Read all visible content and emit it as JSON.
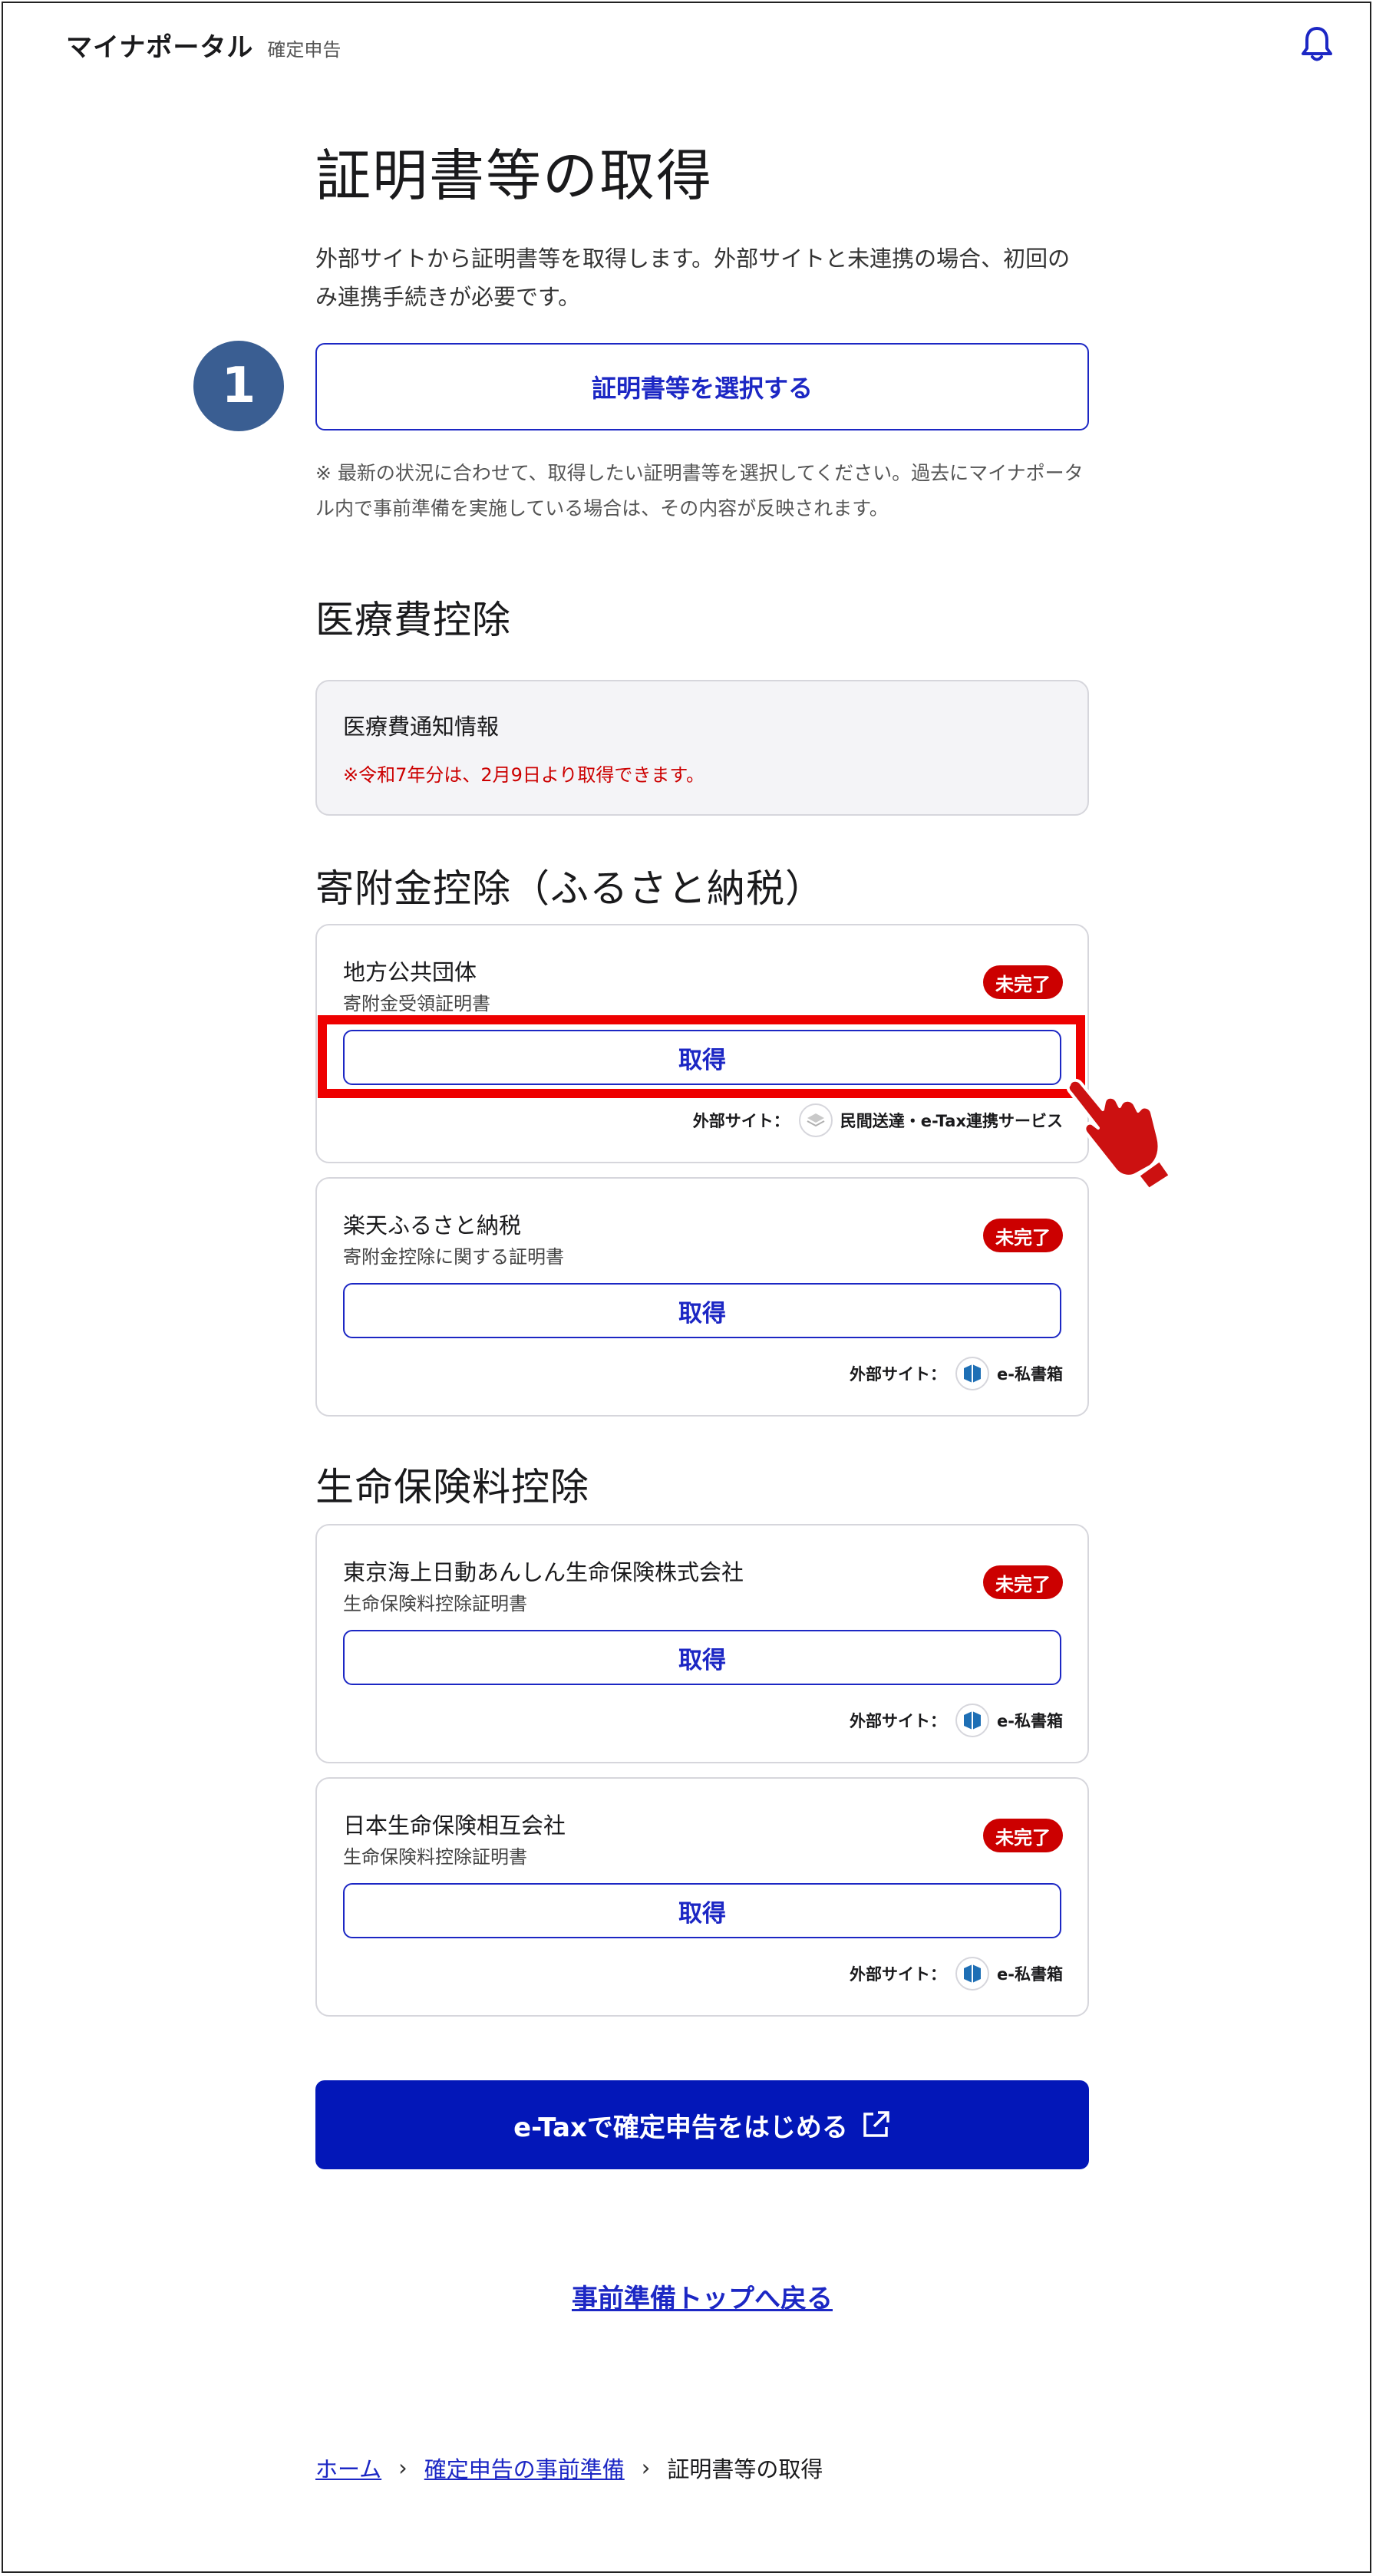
{
  "header": {
    "brand": "マイナポータル",
    "sub": "確定申告"
  },
  "page_title": "証明書等の取得",
  "lead": "外部サイトから証明書等を取得します。外部サイトと未連携の場合、初回のみ連携手続きが必要です。",
  "step_number": "1",
  "select_button": "証明書等を選択する",
  "note": "※ 最新の状況に合わせて、取得したい証明書等を選択してください。過去にマイナポータル内で事前準備を実施している場合は、その内容が反映されます。",
  "sections": {
    "medical": {
      "heading": "医療費控除",
      "card_title": "医療費通知情報",
      "card_warning": "※令和7年分は、2月9日より取得できます。"
    },
    "donation": {
      "heading": "寄附金控除（ふるさと納税）",
      "cards": [
        {
          "title": "地方公共団体",
          "subtitle": "寄附金受領証明書",
          "status": "未完了",
          "button": "取得",
          "ext_label": "外部サイト：",
          "ext_name": "民間送達・e-Tax連携サービス"
        },
        {
          "title": "楽天ふるさと納税",
          "subtitle": "寄附金控除に関する証明書",
          "status": "未完了",
          "button": "取得",
          "ext_label": "外部サイト：",
          "ext_name": "e-私書箱"
        }
      ]
    },
    "life": {
      "heading": "生命保険料控除",
      "cards": [
        {
          "title": "東京海上日動あんしん生命保険株式会社",
          "subtitle": "生命保険料控除証明書",
          "status": "未完了",
          "button": "取得",
          "ext_label": "外部サイト：",
          "ext_name": "e-私書箱"
        },
        {
          "title": "日本生命保険相互会社",
          "subtitle": "生命保険料控除証明書",
          "status": "未完了",
          "button": "取得",
          "ext_label": "外部サイト：",
          "ext_name": "e-私書箱"
        }
      ]
    }
  },
  "etax_button": "e-Taxで確定申告をはじめる",
  "back_link": "事前準備トップへ戻る",
  "breadcrumb": {
    "home": "ホーム",
    "prep": "確定申告の事前準備",
    "current": "証明書等の取得"
  },
  "colors": {
    "primary": "#0317b8",
    "badge": "#cc0000",
    "highlight": "#ee0000",
    "step_circle": "#3a5e92"
  },
  "icons": {
    "bell": "bell-icon",
    "external": "external-link-icon",
    "eshibako": "e-shibako-logo-icon",
    "minkan": "minkan-soutatsu-logo-icon",
    "pointer": "pointing-hand-icon"
  }
}
